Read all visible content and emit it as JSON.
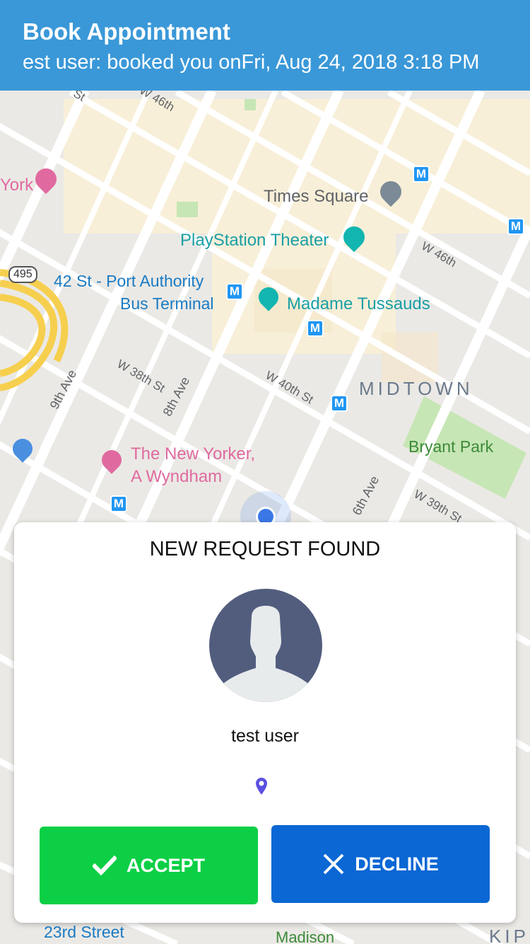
{
  "notification": {
    "title": "Book Appointment",
    "message": "est user: booked you onFri, Aug 24, 2018  3:18 PM"
  },
  "map": {
    "places": {
      "times_square": "Times Square",
      "playstation_theater": "PlayStation Theater",
      "port_authority_1": "42 St - Port Authority",
      "port_authority_2": "Bus Terminal",
      "madame_tussauds": "Madame Tussauds",
      "midtown": "MIDTOWN",
      "bryant_park": "Bryant Park",
      "new_yorker_1": "The New Yorker,",
      "new_yorker_2": "A Wyndham",
      "york": "York",
      "twenty_third": "23rd Street",
      "madison": "Madison",
      "kip": "KIP"
    },
    "streets": {
      "w46_top": "W 46th",
      "w46_right": "W 46th",
      "w38": "W 38th St",
      "w40": "W 40th St",
      "ave9": "9th Ave",
      "ave8": "8th Ave",
      "ave6": "6th Ave",
      "w39": "W 39th St",
      "st_top": "St"
    },
    "route_shield": "495",
    "metro_glyph": "M"
  },
  "request_card": {
    "title": "NEW REQUEST FOUND",
    "user_name": "test user",
    "accept_label": "ACCEPT",
    "decline_label": "DECLINE"
  },
  "colors": {
    "accept": "#0ccf45",
    "decline": "#0a67d4",
    "header": "#3a98d8"
  }
}
